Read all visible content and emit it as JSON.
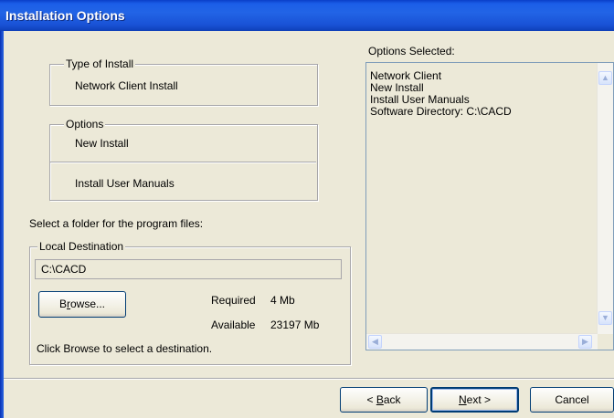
{
  "window": {
    "title": "Installation Options"
  },
  "type_group": {
    "legend": "Type of Install",
    "value": "Network Client Install"
  },
  "options_group": {
    "legend": "Options",
    "items": [
      "New Install",
      "Install User Manuals"
    ]
  },
  "folder_prompt": "Select a folder for the program files:",
  "destination_group": {
    "legend": "Local Destination",
    "path": "C:\\CACD",
    "browse_label_pre": "B",
    "browse_label_u": "r",
    "browse_label_post": "owse...",
    "required_label": "Required",
    "required_value": "4 Mb",
    "available_label": "Available",
    "available_value": "23197 Mb",
    "hint": "Click Browse to select a destination."
  },
  "selected": {
    "label": "Options Selected:",
    "lines": [
      "Network Client",
      "New Install",
      "Install User Manuals",
      "Software Directory: C:\\CACD"
    ]
  },
  "buttons": {
    "back_pre": "< ",
    "back_u": "B",
    "back_post": "ack",
    "next_u": "N",
    "next_post": "ext >",
    "cancel": "Cancel"
  },
  "colors": {
    "title_bar": "#1b5ee8",
    "dialog_bg": "#ece9d8",
    "button_border": "#003c74"
  }
}
